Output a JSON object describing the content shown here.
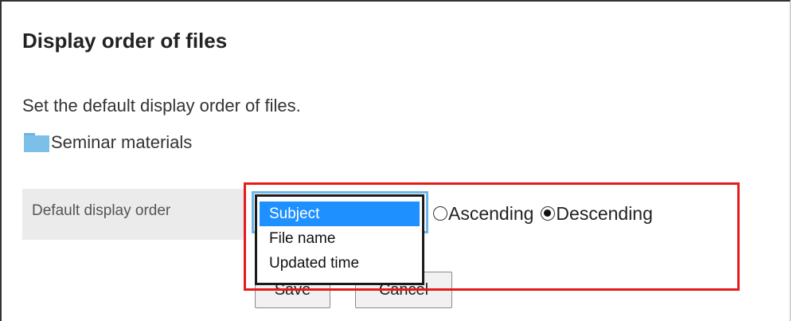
{
  "page": {
    "title": "Display order of files",
    "description": "Set the default display order of files."
  },
  "folder": {
    "icon": "folder-icon",
    "name": "Seminar materials"
  },
  "setting": {
    "label": "Default display order",
    "sort_field": {
      "selected": "Subject",
      "options": [
        {
          "label": "Subject",
          "selected": true
        },
        {
          "label": "File name",
          "selected": false
        },
        {
          "label": "Updated time",
          "selected": false
        }
      ]
    },
    "direction": {
      "options": [
        {
          "label": "Ascending",
          "checked": false
        },
        {
          "label": "Descending",
          "checked": true
        }
      ]
    }
  },
  "actions": {
    "save_label": "Save",
    "cancel_label": "Cancel"
  },
  "colors": {
    "highlight": "#e51b1b",
    "option_selected_bg": "#1e90ff",
    "folder": "#7cc0ea",
    "label_cell_bg": "#ebebeb"
  }
}
